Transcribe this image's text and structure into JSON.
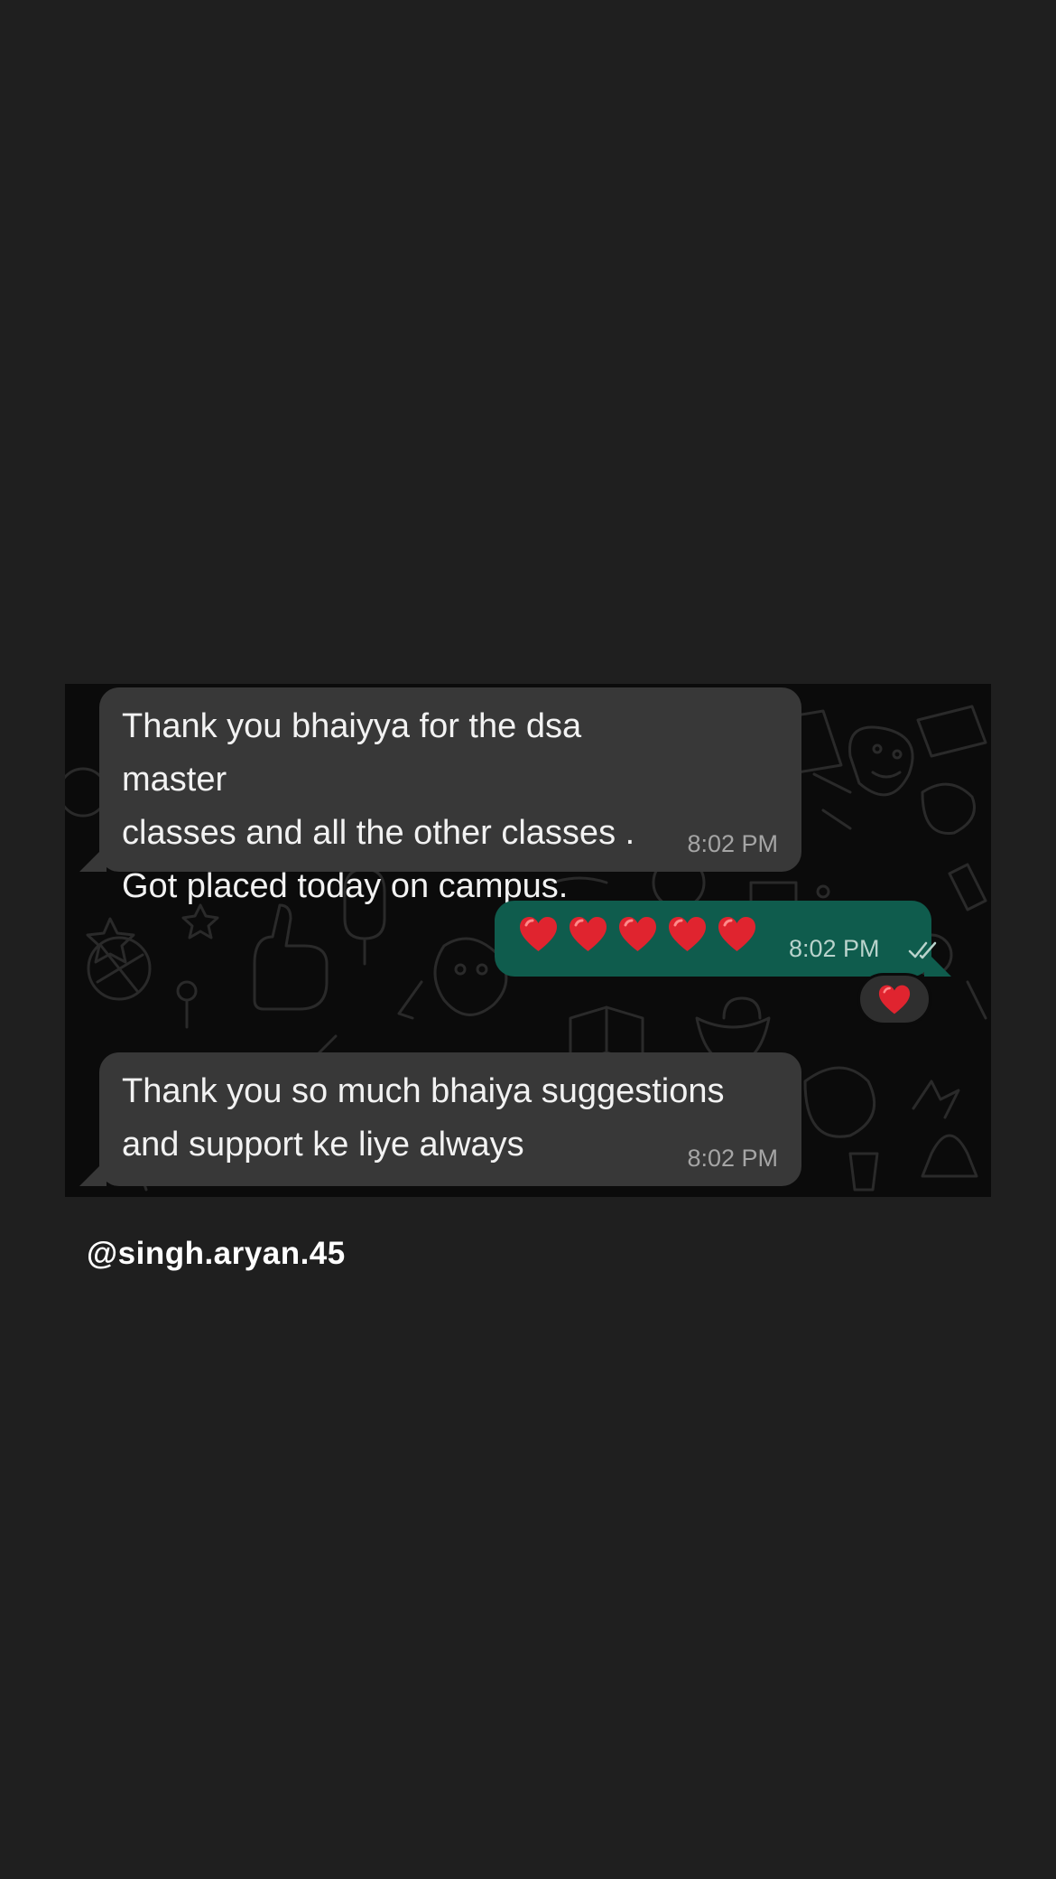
{
  "chat": {
    "messages": [
      {
        "direction": "incoming",
        "text": "Thank you bhaiyya for the dsa master\nclasses and all the other classes .\nGot placed today on campus.",
        "time": "8:02 PM"
      },
      {
        "direction": "outgoing",
        "emoji": [
          "red-heart",
          "red-heart",
          "red-heart",
          "red-heart",
          "red-heart"
        ],
        "time": "8:02 PM",
        "status_icon": "double-check-icon",
        "reaction": "red-heart"
      },
      {
        "direction": "incoming",
        "text": "Thank you so much bhaiya suggestions\nand support ke liye always",
        "time": "8:02 PM"
      }
    ]
  },
  "caption": {
    "handle": "@singh.aryan.45"
  },
  "colors": {
    "page_background": "#1f1f1f",
    "chat_background": "#0b0b0b",
    "incoming_bubble": "#383838",
    "outgoing_bubble": "#0f5c4d",
    "heart": "#e0242f"
  }
}
